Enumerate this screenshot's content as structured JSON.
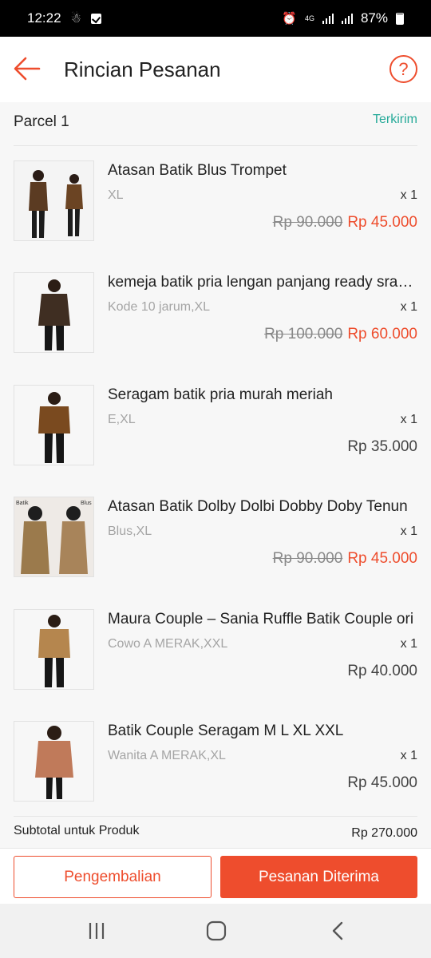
{
  "status_bar": {
    "time": "12:22",
    "network": "4G",
    "battery": "87%"
  },
  "header": {
    "title": "Rincian Pesanan",
    "help_label": "?"
  },
  "parcel": {
    "title": "Parcel 1",
    "status": "Terkirim"
  },
  "products": [
    {
      "name": "Atasan Batik Blus Trompet",
      "variant": "XL",
      "qty": "x 1",
      "old_price": "Rp 90.000",
      "price": "Rp 45.000",
      "discounted": true
    },
    {
      "name": "kemeja batik pria lengan panjang ready sragen",
      "variant": "Kode 10 jarum,XL",
      "qty": "x 1",
      "old_price": "Rp 100.000",
      "price": "Rp 60.000",
      "discounted": true
    },
    {
      "name": "Seragam batik pria murah meriah",
      "variant": "E,XL",
      "qty": "x 1",
      "old_price": "",
      "price": "Rp 35.000",
      "discounted": false
    },
    {
      "name": "Atasan Batik Dolby Dolbi Dobby Doby Tenun",
      "variant": "Blus,XL",
      "qty": "x 1",
      "old_price": "Rp 90.000",
      "price": "Rp 45.000",
      "discounted": true
    },
    {
      "name": "Maura Couple – Sania Ruffle Batik Couple ori",
      "variant": "Cowo A MERAK,XXL",
      "qty": "x 1",
      "old_price": "",
      "price": "Rp 40.000",
      "discounted": false
    },
    {
      "name": "Batik Couple Seragam M L XL XXL",
      "variant": "Wanita A MERAK,XL",
      "qty": "x 1",
      "old_price": "",
      "price": "Rp 45.000",
      "discounted": false
    }
  ],
  "thumb_labels": {
    "p4_left": "Batik",
    "p4_right": "Blus"
  },
  "subtotal": {
    "label": "Subtotal untuk Produk",
    "value": "Rp 270.000"
  },
  "actions": {
    "return_label": "Pengembalian",
    "received_label": "Pesanan Diterima"
  },
  "colors": {
    "accent": "#ee4d2d",
    "status_green": "#26aa99"
  },
  "icons": {
    "back": "arrow-left-icon",
    "help": "question-circle-icon",
    "nav_recent": "recent-apps-icon",
    "nav_home": "home-icon",
    "nav_back": "back-chevron-icon"
  }
}
